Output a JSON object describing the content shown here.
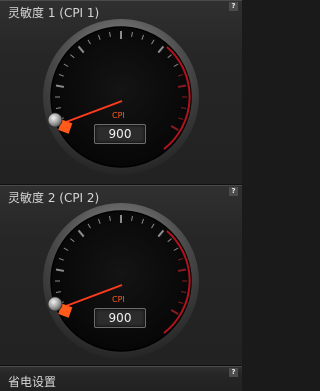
{
  "panels": [
    {
      "title": "灵敏度 1 (CPI 1)",
      "unit": "CPI",
      "value": "900",
      "level": 0.0
    },
    {
      "title": "灵敏度 2 (CPI 2)",
      "unit": "CPI",
      "value": "900",
      "level": 0.0
    }
  ],
  "bottom": {
    "title": "省电设置"
  },
  "help_label": "?",
  "colors": {
    "needle": "#ff3b1f",
    "arc": "#b3131e",
    "handle": "#ff5a1a"
  }
}
